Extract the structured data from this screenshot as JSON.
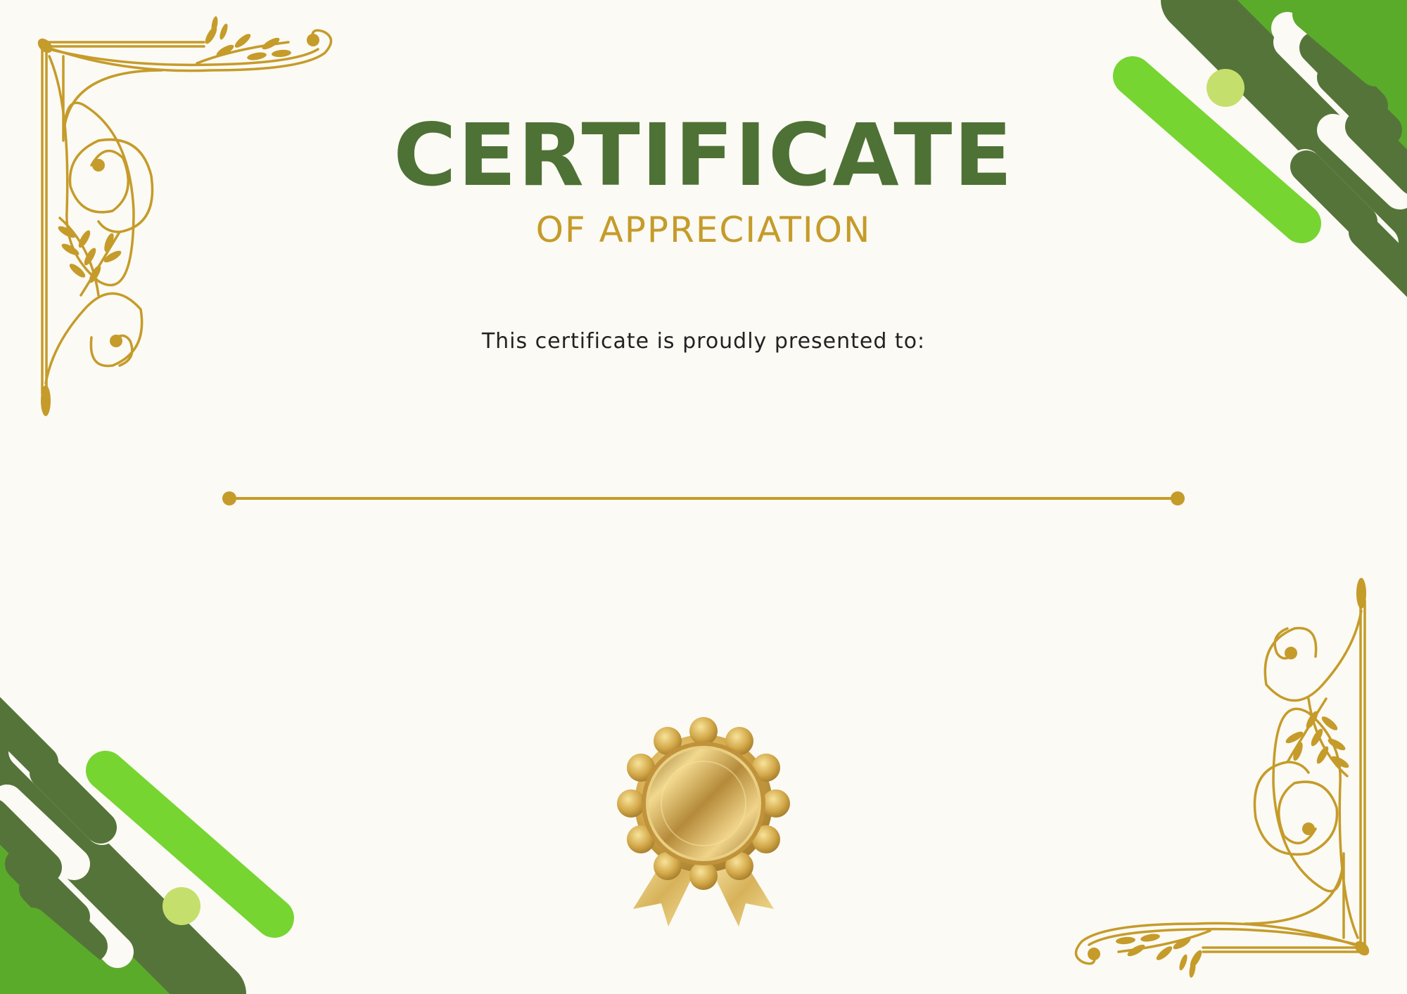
{
  "certificate": {
    "title": "CERTIFICATE",
    "subtitle": "OF APPRECIATION",
    "presented_line": "This certificate is proudly presented to:"
  },
  "decor": {
    "corner_ornaments": [
      "gold-floral-corner-ornament",
      "gold-floral-corner-ornament"
    ],
    "corner_shapes": [
      "green-diagonal-pill-shapes",
      "green-diagonal-pill-shapes"
    ],
    "medal": "gold-seal-medal-icon"
  },
  "colors": {
    "background": "#fbfaf4",
    "title": "#4e7135",
    "gold": "#c59b2a",
    "text": "#222222",
    "dark_green": "#55743a",
    "bright_green": "#76d531",
    "mid_green": "#5bab2b",
    "pale_green": "#c5df6c"
  }
}
